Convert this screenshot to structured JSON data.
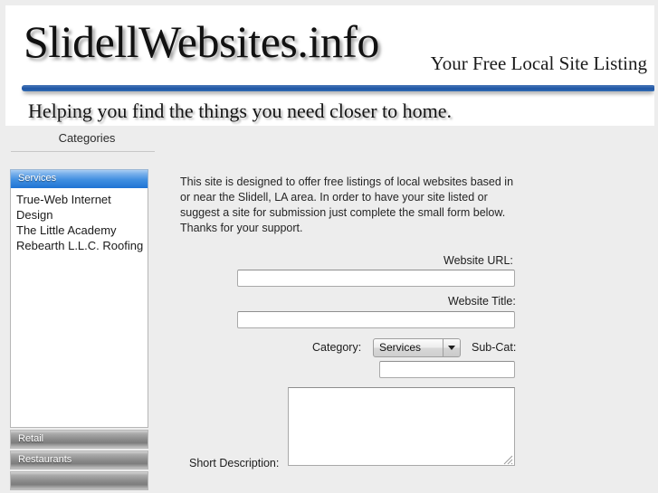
{
  "banner": {
    "title": "SlidellWebsites.info",
    "tagline": "Your Free Local Site Listing",
    "subtitle": "Helping you find the things you need closer to home."
  },
  "nav": {
    "categories_label": "Categories"
  },
  "sidebar": {
    "groups": [
      {
        "label": "Services",
        "state": "active",
        "links": [
          "True-Web Internet Design",
          "The Little Academy",
          "Rebearth L.L.C. Roofing"
        ]
      },
      {
        "label": "Retail",
        "state": "inactive",
        "links": []
      },
      {
        "label": "Restaurants",
        "state": "inactive",
        "links": []
      }
    ]
  },
  "main": {
    "intro": "This site is designed to offer free listings of local websites based in or near the Slidell, LA area. In order to have your site listed or suggest a site for submission just complete the small form below. Thanks for your support."
  },
  "form": {
    "url_label": "Website URL:",
    "url_value": "",
    "title_label": "Website Title:",
    "title_value": "",
    "category_label": "Category:",
    "category_selected": "Services",
    "category_options": [
      "Services",
      "Retail",
      "Restaurants"
    ],
    "subcat_label": "Sub-Cat:",
    "subcat_value": "",
    "description_label": "Short Description:",
    "description_value": ""
  },
  "colors": {
    "page_background": "#ededed",
    "banner_background": "#ffffff",
    "accent_blue": "#2f63ad",
    "active_item_blue": "#3f8ee0",
    "inactive_item_gray": "#8a8a8a"
  }
}
